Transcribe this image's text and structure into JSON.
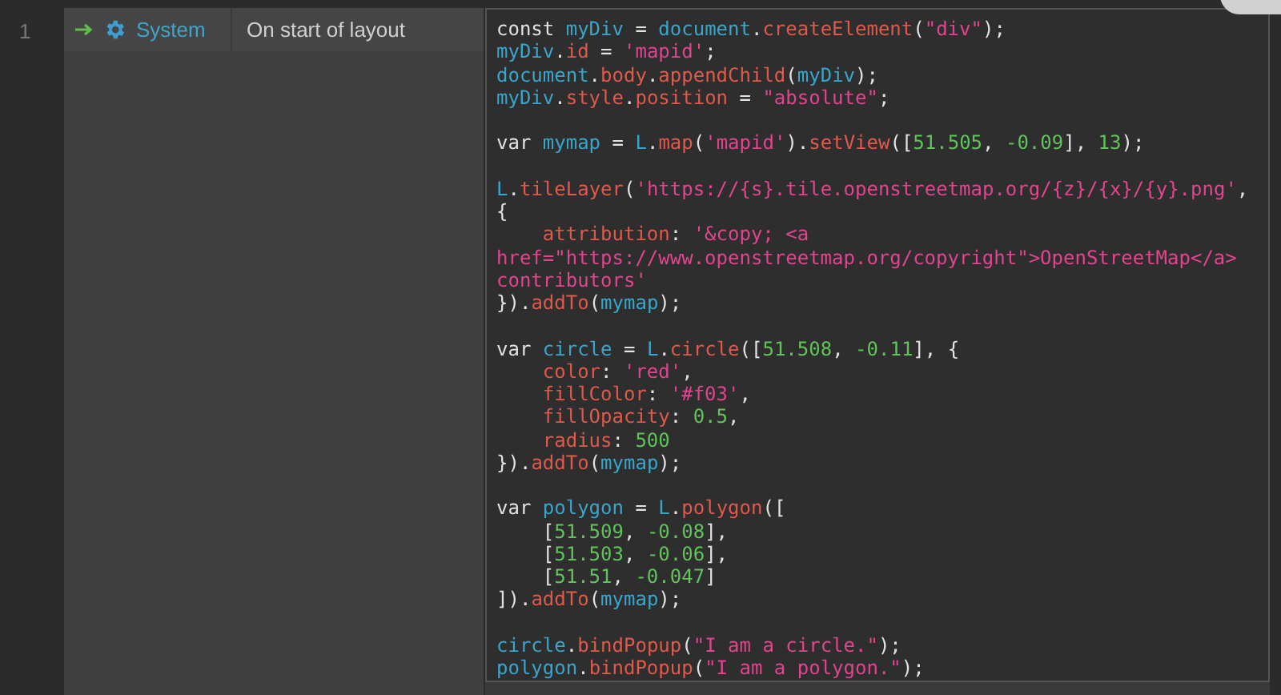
{
  "event_sheet": {
    "line_number": "1",
    "event": {
      "object": "System",
      "condition": "On start of layout",
      "code": [
        {
          "kind": "code",
          "tokens": [
            {
              "kind": "plain",
              "text": "const "
            },
            {
              "kind": "var",
              "text": "myDiv"
            },
            {
              "kind": "plain",
              "text": " = "
            },
            {
              "kind": "var",
              "text": "document"
            },
            {
              "kind": "plain",
              "text": "."
            },
            {
              "kind": "member",
              "text": "createElement"
            },
            {
              "kind": "plain",
              "text": "("
            },
            {
              "kind": "string",
              "text": "\"div\""
            },
            {
              "kind": "plain",
              "text": ");"
            }
          ]
        },
        {
          "kind": "code",
          "tokens": [
            {
              "kind": "var",
              "text": "myDiv"
            },
            {
              "kind": "plain",
              "text": "."
            },
            {
              "kind": "member",
              "text": "id"
            },
            {
              "kind": "plain",
              "text": " = "
            },
            {
              "kind": "string",
              "text": "'mapid'"
            },
            {
              "kind": "plain",
              "text": ";"
            }
          ]
        },
        {
          "kind": "code",
          "tokens": [
            {
              "kind": "var",
              "text": "document"
            },
            {
              "kind": "plain",
              "text": "."
            },
            {
              "kind": "member",
              "text": "body"
            },
            {
              "kind": "plain",
              "text": "."
            },
            {
              "kind": "member",
              "text": "appendChild"
            },
            {
              "kind": "plain",
              "text": "("
            },
            {
              "kind": "var",
              "text": "myDiv"
            },
            {
              "kind": "plain",
              "text": ");"
            }
          ]
        },
        {
          "kind": "code",
          "tokens": [
            {
              "kind": "var",
              "text": "myDiv"
            },
            {
              "kind": "plain",
              "text": "."
            },
            {
              "kind": "member",
              "text": "style"
            },
            {
              "kind": "plain",
              "text": "."
            },
            {
              "kind": "member",
              "text": "position"
            },
            {
              "kind": "plain",
              "text": " = "
            },
            {
              "kind": "string",
              "text": "\"absolute\""
            },
            {
              "kind": "plain",
              "text": ";"
            }
          ]
        },
        {
          "kind": "blank"
        },
        {
          "kind": "code",
          "tokens": [
            {
              "kind": "plain",
              "text": "var "
            },
            {
              "kind": "var",
              "text": "mymap"
            },
            {
              "kind": "plain",
              "text": " = "
            },
            {
              "kind": "var",
              "text": "L"
            },
            {
              "kind": "plain",
              "text": "."
            },
            {
              "kind": "member",
              "text": "map"
            },
            {
              "kind": "plain",
              "text": "("
            },
            {
              "kind": "string",
              "text": "'mapid'"
            },
            {
              "kind": "plain",
              "text": ")."
            },
            {
              "kind": "member",
              "text": "setView"
            },
            {
              "kind": "plain",
              "text": "(["
            },
            {
              "kind": "number",
              "text": "51.505"
            },
            {
              "kind": "plain",
              "text": ", "
            },
            {
              "kind": "number",
              "text": "-0.09"
            },
            {
              "kind": "plain",
              "text": "], "
            },
            {
              "kind": "number",
              "text": "13"
            },
            {
              "kind": "plain",
              "text": ");"
            }
          ]
        },
        {
          "kind": "blank"
        },
        {
          "kind": "code",
          "tokens": [
            {
              "kind": "var",
              "text": "L"
            },
            {
              "kind": "plain",
              "text": "."
            },
            {
              "kind": "member",
              "text": "tileLayer"
            },
            {
              "kind": "plain",
              "text": "("
            },
            {
              "kind": "string",
              "text": "'https://{s}.tile.openstreetmap.org/{z}/{x}/{y}.png'"
            },
            {
              "kind": "plain",
              "text": ","
            }
          ]
        },
        {
          "kind": "code",
          "tokens": [
            {
              "kind": "plain",
              "text": "{"
            }
          ]
        },
        {
          "kind": "code",
          "indented": true,
          "tokens": [
            {
              "kind": "member",
              "text": "attribution"
            },
            {
              "kind": "plain",
              "text": ": "
            },
            {
              "kind": "string",
              "text": "'&copy; <a"
            }
          ]
        },
        {
          "kind": "code",
          "tokens": [
            {
              "kind": "string",
              "text": "href=\"https://www.openstreetmap.org/copyright\">OpenStreetMap</a>"
            }
          ]
        },
        {
          "kind": "code",
          "tokens": [
            {
              "kind": "string",
              "text": "contributors'"
            }
          ]
        },
        {
          "kind": "code",
          "tokens": [
            {
              "kind": "plain",
              "text": "})."
            },
            {
              "kind": "member",
              "text": "addTo"
            },
            {
              "kind": "plain",
              "text": "("
            },
            {
              "kind": "var",
              "text": "mymap"
            },
            {
              "kind": "plain",
              "text": ");"
            }
          ]
        },
        {
          "kind": "blank"
        },
        {
          "kind": "code",
          "tokens": [
            {
              "kind": "plain",
              "text": "var "
            },
            {
              "kind": "var",
              "text": "circle"
            },
            {
              "kind": "plain",
              "text": " = "
            },
            {
              "kind": "var",
              "text": "L"
            },
            {
              "kind": "plain",
              "text": "."
            },
            {
              "kind": "member",
              "text": "circle"
            },
            {
              "kind": "plain",
              "text": "(["
            },
            {
              "kind": "number",
              "text": "51.508"
            },
            {
              "kind": "plain",
              "text": ", "
            },
            {
              "kind": "number",
              "text": "-0.11"
            },
            {
              "kind": "plain",
              "text": "], {"
            }
          ]
        },
        {
          "kind": "code",
          "indented": true,
          "tokens": [
            {
              "kind": "member",
              "text": "color"
            },
            {
              "kind": "plain",
              "text": ": "
            },
            {
              "kind": "string",
              "text": "'red'"
            },
            {
              "kind": "plain",
              "text": ","
            }
          ]
        },
        {
          "kind": "code",
          "indented": true,
          "tokens": [
            {
              "kind": "member",
              "text": "fillColor"
            },
            {
              "kind": "plain",
              "text": ": "
            },
            {
              "kind": "string",
              "text": "'#f03'"
            },
            {
              "kind": "plain",
              "text": ","
            }
          ]
        },
        {
          "kind": "code",
          "indented": true,
          "tokens": [
            {
              "kind": "member",
              "text": "fillOpacity"
            },
            {
              "kind": "plain",
              "text": ": "
            },
            {
              "kind": "number",
              "text": "0.5"
            },
            {
              "kind": "plain",
              "text": ","
            }
          ]
        },
        {
          "kind": "code",
          "indented": true,
          "tokens": [
            {
              "kind": "member",
              "text": "radius"
            },
            {
              "kind": "plain",
              "text": ": "
            },
            {
              "kind": "number",
              "text": "500"
            }
          ]
        },
        {
          "kind": "code",
          "tokens": [
            {
              "kind": "plain",
              "text": "})."
            },
            {
              "kind": "member",
              "text": "addTo"
            },
            {
              "kind": "plain",
              "text": "("
            },
            {
              "kind": "var",
              "text": "mymap"
            },
            {
              "kind": "plain",
              "text": ");"
            }
          ]
        },
        {
          "kind": "blank"
        },
        {
          "kind": "code",
          "tokens": [
            {
              "kind": "plain",
              "text": "var "
            },
            {
              "kind": "var",
              "text": "polygon"
            },
            {
              "kind": "plain",
              "text": " = "
            },
            {
              "kind": "var",
              "text": "L"
            },
            {
              "kind": "plain",
              "text": "."
            },
            {
              "kind": "member",
              "text": "polygon"
            },
            {
              "kind": "plain",
              "text": "(["
            }
          ]
        },
        {
          "kind": "code",
          "indented": true,
          "tokens": [
            {
              "kind": "plain",
              "text": "["
            },
            {
              "kind": "number",
              "text": "51.509"
            },
            {
              "kind": "plain",
              "text": ", "
            },
            {
              "kind": "number",
              "text": "-0.08"
            },
            {
              "kind": "plain",
              "text": "],"
            }
          ]
        },
        {
          "kind": "code",
          "indented": true,
          "tokens": [
            {
              "kind": "plain",
              "text": "["
            },
            {
              "kind": "number",
              "text": "51.503"
            },
            {
              "kind": "plain",
              "text": ", "
            },
            {
              "kind": "number",
              "text": "-0.06"
            },
            {
              "kind": "plain",
              "text": "],"
            }
          ]
        },
        {
          "kind": "code",
          "indented": true,
          "tokens": [
            {
              "kind": "plain",
              "text": "["
            },
            {
              "kind": "number",
              "text": "51.51"
            },
            {
              "kind": "plain",
              "text": ", "
            },
            {
              "kind": "number",
              "text": "-0.047"
            },
            {
              "kind": "plain",
              "text": "]"
            }
          ]
        },
        {
          "kind": "code",
          "tokens": [
            {
              "kind": "plain",
              "text": "])."
            },
            {
              "kind": "member",
              "text": "addTo"
            },
            {
              "kind": "plain",
              "text": "("
            },
            {
              "kind": "var",
              "text": "mymap"
            },
            {
              "kind": "plain",
              "text": ");"
            }
          ]
        },
        {
          "kind": "blank"
        },
        {
          "kind": "code",
          "tokens": [
            {
              "kind": "var",
              "text": "circle"
            },
            {
              "kind": "plain",
              "text": "."
            },
            {
              "kind": "member",
              "text": "bindPopup"
            },
            {
              "kind": "plain",
              "text": "("
            },
            {
              "kind": "string",
              "text": "\"I am a circle.\""
            },
            {
              "kind": "plain",
              "text": ");"
            }
          ]
        },
        {
          "kind": "code",
          "tokens": [
            {
              "kind": "var",
              "text": "polygon"
            },
            {
              "kind": "plain",
              "text": "."
            },
            {
              "kind": "member",
              "text": "bindPopup"
            },
            {
              "kind": "plain",
              "text": "("
            },
            {
              "kind": "string",
              "text": "\"I am a polygon.\""
            },
            {
              "kind": "plain",
              "text": ");"
            }
          ]
        }
      ]
    }
  }
}
